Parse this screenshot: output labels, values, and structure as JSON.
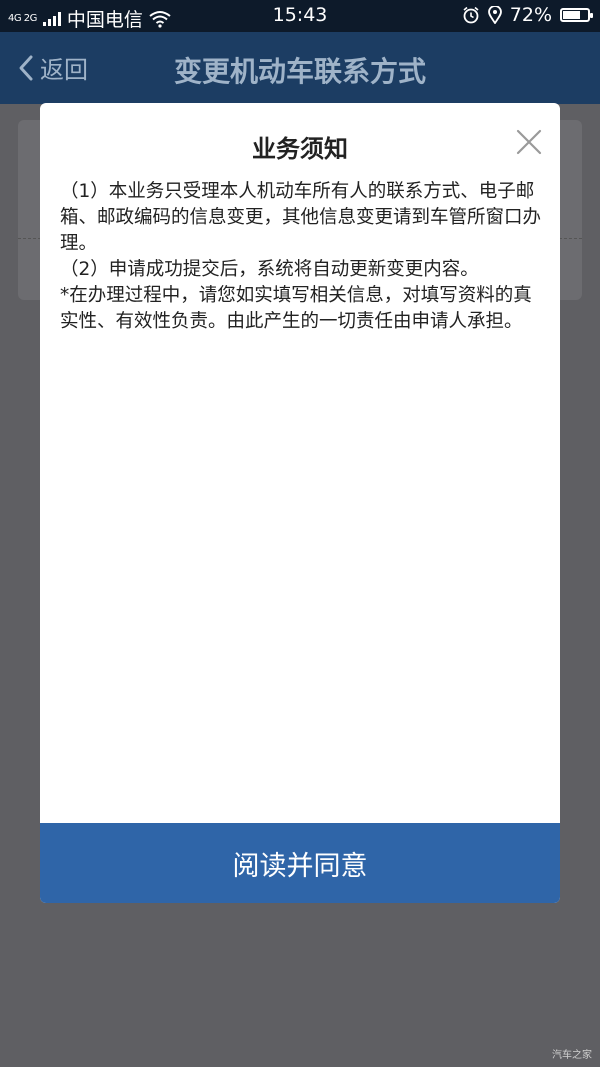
{
  "status_bar": {
    "network": "4G 2G",
    "carrier": "中国电信",
    "time": "15:43",
    "battery": "72%",
    "battery_level": 0.72,
    "icons": [
      "signal-icon",
      "wifi-icon",
      "alarm-icon",
      "location-icon",
      "battery-icon"
    ]
  },
  "nav": {
    "back_label": "返回",
    "title": "变更机动车联系方式"
  },
  "modal": {
    "title": "业务须知",
    "paragraphs": [
      "（1）本业务只受理本人机动车所有人的联系方式、电子邮箱、邮政编码的信息变更，其他信息变更请到车管所窗口办理。",
      "（2）申请成功提交后，系统将自动更新变更内容。",
      "*在办理过程中，请您如实填写相关信息，对填写资料的真实性、有效性负责。由此产生的一切责任由申请人承担。"
    ],
    "agree_label": "阅读并同意"
  },
  "watermark": "汽车之家",
  "colors": {
    "nav_bg": "#1c3d63",
    "button_bg": "#2f65a8",
    "overlay": "#5f5f63"
  }
}
